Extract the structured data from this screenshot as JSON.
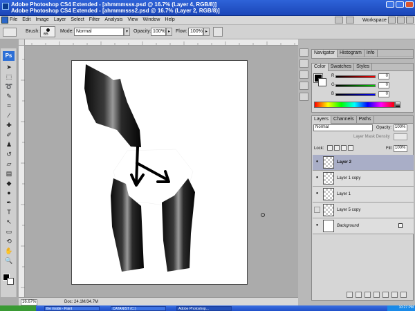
{
  "window": {
    "title_back": "Adobe Photoshop CS4 Extended - [ahmmmsss.psd @ 16.7% (Layer 4, RGB/8)]",
    "title_front": "Adobe Photoshop CS4 Extended - [ahmmmsss2.psd @ 16.7% (Layer 2, RGB/8)]"
  },
  "menu": {
    "items": [
      "File",
      "Edit",
      "Image",
      "Layer",
      "Select",
      "Filter",
      "Analysis",
      "View",
      "Window",
      "Help"
    ],
    "workspace": "Workspace"
  },
  "options": {
    "brush_label": "Brush:",
    "brush_size": "65",
    "mode_label": "Mode:",
    "mode_value": "Normal",
    "opacity_label": "Opacity:",
    "opacity_value": "100%",
    "flow_label": "Flow:",
    "flow_value": "100%"
  },
  "toolbox": {
    "logo": "Ps"
  },
  "color_panel": {
    "tabs": [
      "Color",
      "Swatches",
      "Styles"
    ],
    "labels": [
      "R",
      "G",
      "B"
    ],
    "values": [
      "0",
      "0",
      "0"
    ]
  },
  "navigator_panel": {
    "tabs": [
      "Navigator",
      "Histogram",
      "Info"
    ]
  },
  "layers_panel": {
    "tabs": [
      "Layers",
      "Channels",
      "Paths"
    ],
    "blend_mode": "Normal",
    "opacity_label": "Opacity:",
    "opacity_value": "100%",
    "mask_density_label": "Layer Mask Density",
    "lock_label": "Lock:",
    "fill_label": "Fill:",
    "fill_value": "100%",
    "layers": [
      {
        "name": "Layer 2",
        "visible": true,
        "selected": true
      },
      {
        "name": "Layer 1 copy",
        "visible": true,
        "selected": false
      },
      {
        "name": "Layer 1",
        "visible": true,
        "selected": false
      },
      {
        "name": "Layer 5 copy",
        "visible": false,
        "selected": false
      },
      {
        "name": "Background",
        "visible": true,
        "selected": false,
        "locked": true
      }
    ]
  },
  "status": {
    "zoom": "16.67%",
    "doc": "Doc: 24.1M/34.7M"
  },
  "taskbar": {
    "tasks": [
      "the inside - Paint",
      "CATANIST (C:)",
      "Adobe Photoshop..."
    ],
    "clock": "10:27 PM"
  }
}
